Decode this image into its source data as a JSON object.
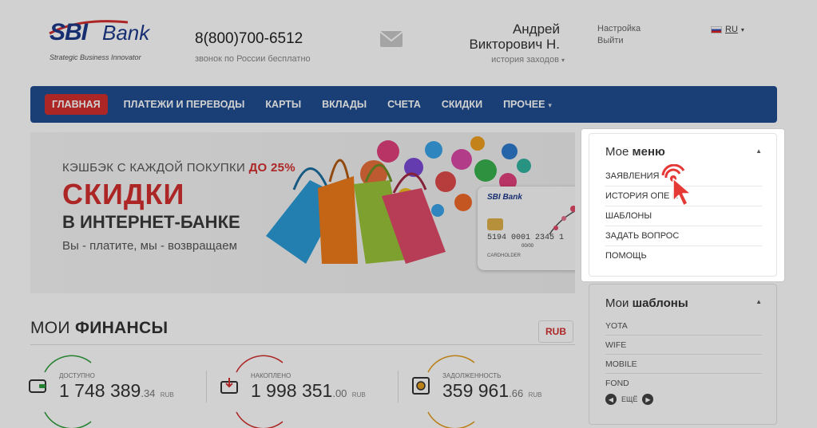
{
  "header": {
    "logo_main": "SBI",
    "logo_bank": "Bank",
    "logo_tagline": "Strategic Business Innovator",
    "phone": "8(800)700-6512",
    "phone_note": "звонок по России бесплатно",
    "user_first": "Андрей",
    "user_last": "Викторович Н.",
    "history_link": "история заходов",
    "settings_link": "Настройка",
    "logout_link": "Выйти",
    "lang": "RU"
  },
  "nav": {
    "items": [
      {
        "label": "ГЛАВНАЯ"
      },
      {
        "label": "ПЛАТЕЖИ И ПЕРЕВОДЫ"
      },
      {
        "label": "КАРТЫ"
      },
      {
        "label": "ВКЛАДЫ"
      },
      {
        "label": "СЧЕТА"
      },
      {
        "label": "СКИДКИ"
      },
      {
        "label": "ПРОЧЕЕ"
      }
    ]
  },
  "banner": {
    "cashback_prefix": "КЭШБЭК С КАЖДОЙ ПОКУПКИ ",
    "cashback_highlight": "ДО 25%",
    "headline": "СКИДКИ",
    "subheadline": "В ИНТЕРНЕТ-БАНКЕ",
    "slogan": "Вы - платите, мы - возвращаем",
    "card_bank": "SBI Bank",
    "card_number": "5194 0001 2345 1",
    "card_date": "00/00",
    "card_holder": "CARDHOLDER"
  },
  "finances": {
    "title_light": "МОИ ",
    "title_bold": "ФИНАНСЫ",
    "currency_button": "RUB",
    "metrics": [
      {
        "label": "доступно",
        "whole": "1 748 389",
        "cents": ".34",
        "currency": "RUB",
        "color": "#2e9d3b"
      },
      {
        "label": "накоплено",
        "whole": "1 998 351",
        "cents": ".00",
        "currency": "RUB",
        "color": "#d32f2f"
      },
      {
        "label": "задолженность",
        "whole": "359 961",
        "cents": ".66",
        "currency": "RUB",
        "color": "#e39b1c"
      }
    ]
  },
  "my_menu": {
    "title_light": "Мое ",
    "title_bold": "меню",
    "items": [
      {
        "label": "ЗАЯВЛЕНИЯ"
      },
      {
        "label": "ИСТОРИЯ ОПЕ     Й"
      },
      {
        "label": "ШАБЛОНЫ"
      },
      {
        "label": "ЗАДАТЬ ВОПРОС"
      },
      {
        "label": "ПОМОЩЬ"
      }
    ]
  },
  "my_templates": {
    "title_light": "Мои ",
    "title_bold": "шаблоны",
    "items": [
      {
        "label": "YOTA"
      },
      {
        "label": "WIFE"
      },
      {
        "label": "MOBILE"
      },
      {
        "label": "FOND"
      }
    ],
    "more_label": "ЕЩЁ"
  },
  "colors": {
    "nav_bg": "#1f4e91",
    "accent_red": "#d32f2f",
    "brand_blue": "#1d3a8a"
  }
}
